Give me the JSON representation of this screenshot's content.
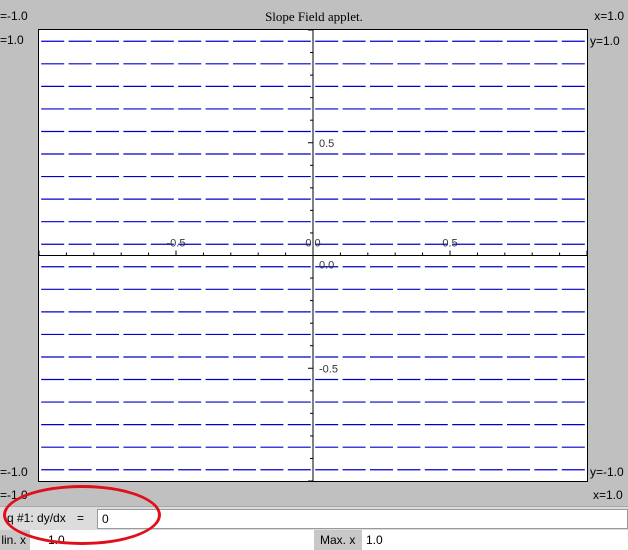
{
  "applet": {
    "title": "Slope Field applet.",
    "corner_top_left": "=-1.0",
    "corner_top_right": "x=1.0",
    "left_top_y": "=1.0",
    "right_top_y": "y=1.0",
    "left_bottom_y": "=-1.0",
    "right_bottom_y": "y=-1.0",
    "corner_bottom_left": "=-1.0",
    "corner_bottom_right": "x=1.0"
  },
  "equation": {
    "label": "q #1: dy/dx",
    "equals": "=",
    "value": "0"
  },
  "range": {
    "min_x_label": "lin. x",
    "min_x_value": "-1.0",
    "max_x_label": "Max. x",
    "max_x_value": "1.0"
  },
  "chart_data": {
    "type": "slope-field",
    "equation": "dy/dx = 0",
    "xlim": [
      -1.0,
      1.0
    ],
    "ylim": [
      -1.0,
      1.0
    ],
    "grid_cols": 20,
    "grid_rows": 20,
    "slope": 0,
    "segment_color": "#0000cc",
    "x_tick_labels": [
      "-0.5",
      "0.0",
      "0.5"
    ],
    "y_tick_labels": [
      "0.5",
      "0.0",
      "-0.5"
    ]
  },
  "colors": {
    "background": "#c0c0c0",
    "plot": "#ffffff",
    "segments": "#0000cc",
    "annotation": "#e0101a"
  }
}
